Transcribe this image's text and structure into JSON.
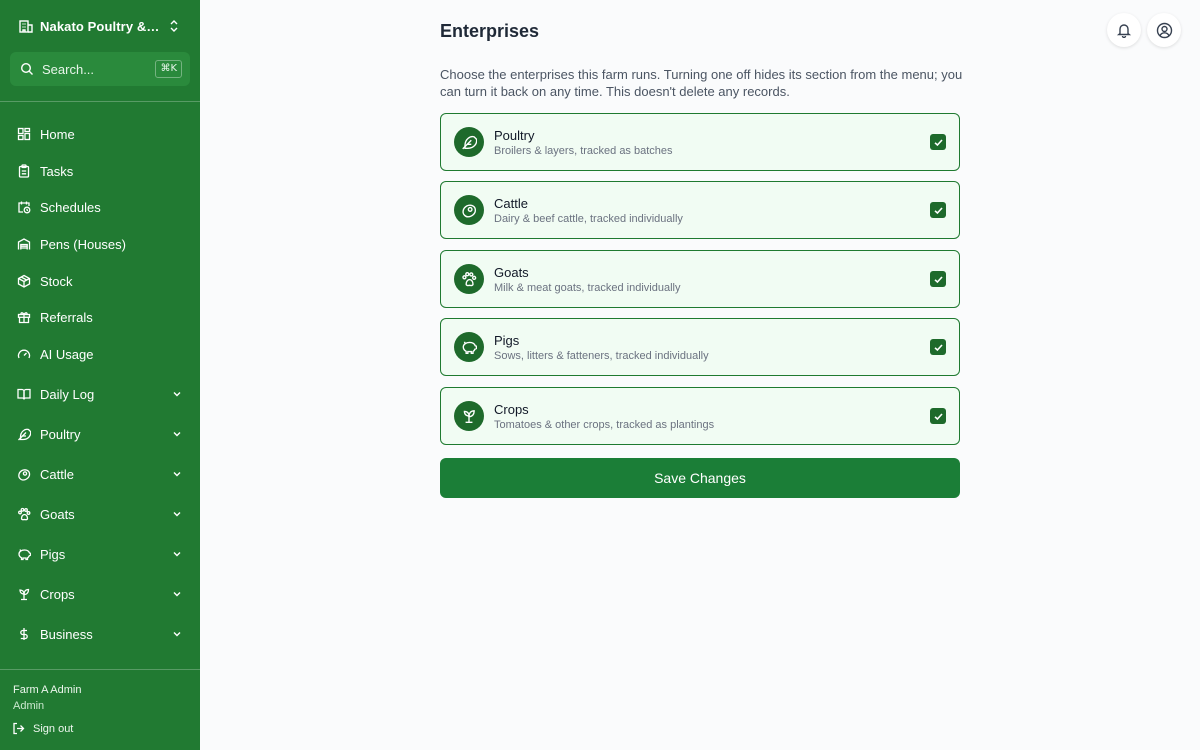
{
  "sidebar": {
    "farm_name": "Nakato Poultry & Da...",
    "search": {
      "placeholder": "Search...",
      "shortcut": "⌘K"
    },
    "items": [
      {
        "label": "Home",
        "icon": "grid-icon"
      },
      {
        "label": "Tasks",
        "icon": "clipboard-icon"
      },
      {
        "label": "Schedules",
        "icon": "calendar-clock-icon"
      },
      {
        "label": "Pens (Houses)",
        "icon": "warehouse-icon"
      },
      {
        "label": "Stock",
        "icon": "package-icon"
      },
      {
        "label": "Referrals",
        "icon": "gift-icon"
      },
      {
        "label": "AI Usage",
        "icon": "gauge-icon"
      }
    ],
    "groups": [
      {
        "label": "Daily Log",
        "icon": "book-open-icon"
      },
      {
        "label": "Poultry",
        "icon": "feather-icon"
      },
      {
        "label": "Cattle",
        "icon": "beef-icon"
      },
      {
        "label": "Goats",
        "icon": "paw-icon"
      },
      {
        "label": "Pigs",
        "icon": "piggy-icon"
      },
      {
        "label": "Crops",
        "icon": "sprout-icon"
      },
      {
        "label": "Business",
        "icon": "dollar-icon"
      }
    ],
    "user": {
      "name": "Farm A Admin",
      "role": "Admin"
    },
    "sign_out": "Sign out"
  },
  "header": {
    "title": "Enterprises"
  },
  "description": "Choose the enterprises this farm runs. Turning one off hides its section from the menu; you can turn it back on any time. This doesn't delete any records.",
  "enterprises": [
    {
      "name": "Poultry",
      "detail": "Broilers & layers, tracked as batches",
      "enabled": true,
      "icon": "feather-icon"
    },
    {
      "name": "Cattle",
      "detail": "Dairy & beef cattle, tracked individually",
      "enabled": true,
      "icon": "beef-icon"
    },
    {
      "name": "Goats",
      "detail": "Milk & meat goats, tracked individually",
      "enabled": true,
      "icon": "paw-icon"
    },
    {
      "name": "Pigs",
      "detail": "Sows, litters & fatteners, tracked individually",
      "enabled": true,
      "icon": "piggy-icon"
    },
    {
      "name": "Crops",
      "detail": "Tomatoes & other crops, tracked as plantings",
      "enabled": true,
      "icon": "sprout-icon"
    }
  ],
  "save_label": "Save Changes",
  "colors": {
    "sidebar": "#217a32",
    "accent": "#1b7e37",
    "card_bg": "#f1fcf3",
    "badge": "#1e6a2b"
  }
}
